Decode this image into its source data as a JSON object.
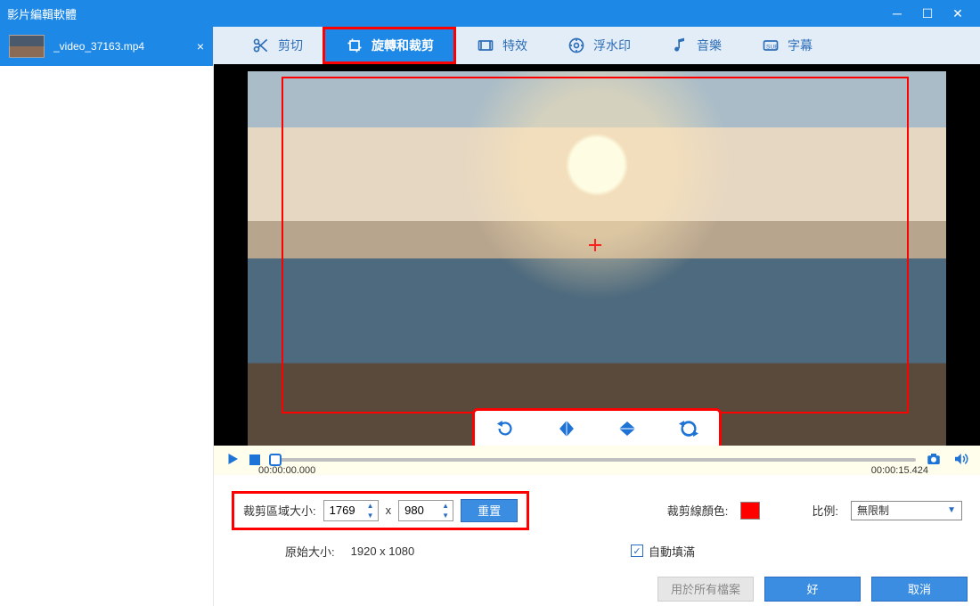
{
  "window": {
    "title": "影片編輯軟體"
  },
  "file": {
    "name": "_video_37163.mp4"
  },
  "tabs": {
    "trim": "剪切",
    "rotate": "旋轉和裁剪",
    "effects": "特效",
    "watermark": "浮水印",
    "music": "音樂",
    "subtitle": "字幕"
  },
  "playback": {
    "current": "00:00:00.000",
    "total": "00:00:15.424"
  },
  "crop": {
    "size_label": "裁剪區域大小:",
    "width": "1769",
    "height": "980",
    "x_sep": "x",
    "reset": "重置",
    "line_color_label": "裁剪線顏色:",
    "ratio_label": "比例:",
    "ratio_value": "無限制",
    "original_label": "原始大小:",
    "original_value": "1920 x 1080",
    "autofill_label": "自動填滿"
  },
  "footer": {
    "apply_all": "用於所有檔案",
    "ok": "好",
    "cancel": "取消"
  },
  "colors": {
    "accent": "#1e88e6",
    "highlight": "#ff0000"
  }
}
